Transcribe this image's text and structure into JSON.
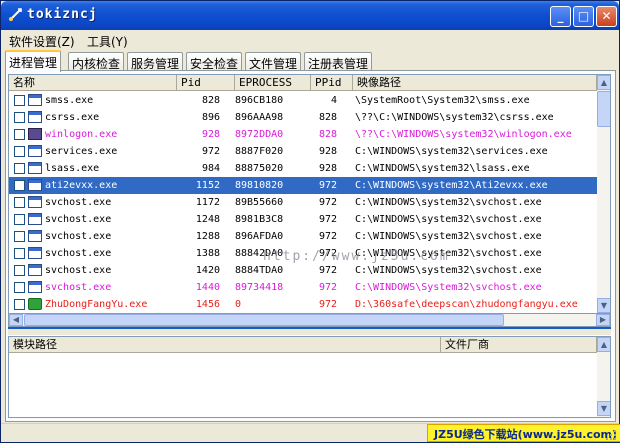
{
  "window": {
    "title": "tokizncj"
  },
  "menu": [
    {
      "label": "软件设置(Z)"
    },
    {
      "label": "工具(Y)"
    }
  ],
  "tabs": [
    {
      "label": "进程管理"
    },
    {
      "label": "内核检查"
    },
    {
      "label": "服务管理"
    },
    {
      "label": "安全检查"
    },
    {
      "label": "文件管理"
    },
    {
      "label": "注册表管理"
    }
  ],
  "process_list": {
    "columns": [
      "名称",
      "Pid",
      "EPROCESS",
      "PPid",
      "映像路径"
    ],
    "rows": [
      {
        "name": "smss.exe",
        "pid": "828",
        "eprocess": "896CB180",
        "ppid": "4",
        "path": "\\SystemRoot\\System32\\smss.exe",
        "color": "#000000",
        "icon": "window-icon"
      },
      {
        "name": "csrss.exe",
        "pid": "896",
        "eprocess": "896AAA98",
        "ppid": "828",
        "path": "\\??\\C:\\WINDOWS\\system32\\csrss.exe",
        "color": "#000000",
        "icon": "window-icon"
      },
      {
        "name": "winlogon.exe",
        "pid": "928",
        "eprocess": "8972DDA0",
        "ppid": "828",
        "path": "\\??\\C:\\WINDOWS\\system32\\winlogon.exe",
        "color": "#d81bd8",
        "icon": "winlogon-icon"
      },
      {
        "name": "services.exe",
        "pid": "972",
        "eprocess": "8887F020",
        "ppid": "928",
        "path": "C:\\WINDOWS\\system32\\services.exe",
        "color": "#000000",
        "icon": "window-icon"
      },
      {
        "name": "lsass.exe",
        "pid": "984",
        "eprocess": "88875020",
        "ppid": "928",
        "path": "C:\\WINDOWS\\system32\\lsass.exe",
        "color": "#000000",
        "icon": "window-icon"
      },
      {
        "name": "ati2evxx.exe",
        "pid": "1152",
        "eprocess": "89810820",
        "ppid": "972",
        "path": "C:\\WINDOWS\\system32\\Ati2evxx.exe",
        "color": "#ffffff",
        "icon": "window-icon",
        "selected": true
      },
      {
        "name": "svchost.exe",
        "pid": "1172",
        "eprocess": "89B55660",
        "ppid": "972",
        "path": "C:\\WINDOWS\\system32\\svchost.exe",
        "color": "#000000",
        "icon": "window-icon"
      },
      {
        "name": "svchost.exe",
        "pid": "1248",
        "eprocess": "8981B3C8",
        "ppid": "972",
        "path": "C:\\WINDOWS\\system32\\svchost.exe",
        "color": "#000000",
        "icon": "window-icon"
      },
      {
        "name": "svchost.exe",
        "pid": "1288",
        "eprocess": "896AFDA0",
        "ppid": "972",
        "path": "C:\\WINDOWS\\system32\\svchost.exe",
        "color": "#000000",
        "icon": "window-icon"
      },
      {
        "name": "svchost.exe",
        "pid": "1388",
        "eprocess": "88842DA0",
        "ppid": "972",
        "path": "C:\\WINDOWS\\system32\\svchost.exe",
        "color": "#000000",
        "icon": "window-icon"
      },
      {
        "name": "svchost.exe",
        "pid": "1420",
        "eprocess": "8884TDA0",
        "ppid": "972",
        "path": "C:\\WINDOWS\\system32\\svchost.exe",
        "color": "#000000",
        "icon": "window-icon"
      },
      {
        "name": "svchost.exe",
        "pid": "1440",
        "eprocess": "89734418",
        "ppid": "972",
        "path": "C:\\WINDOWS\\System32\\svchost.exe",
        "color": "#d81bd8",
        "icon": "window-icon"
      },
      {
        "name": "ZhuDongFangYu.exe",
        "pid": "1456",
        "eprocess": "0",
        "ppid": "972",
        "path": "D:\\360safe\\deepscan\\zhudongfangyu.exe",
        "color": "#e8201a",
        "icon": "shield-plus-icon"
      }
    ]
  },
  "module_list": {
    "columns": [
      "模块路径",
      "文件厂商"
    ]
  },
  "watermark": "http://www.jz5u.com",
  "status_badge": "JZ5U绿色下载站(www.jz5u.com)",
  "colors": {
    "titlebar": "#0b47c6",
    "selection": "#316ac5",
    "warning_pink": "#d81bd8",
    "danger_red": "#e8201a",
    "badge": "#fff22a"
  }
}
